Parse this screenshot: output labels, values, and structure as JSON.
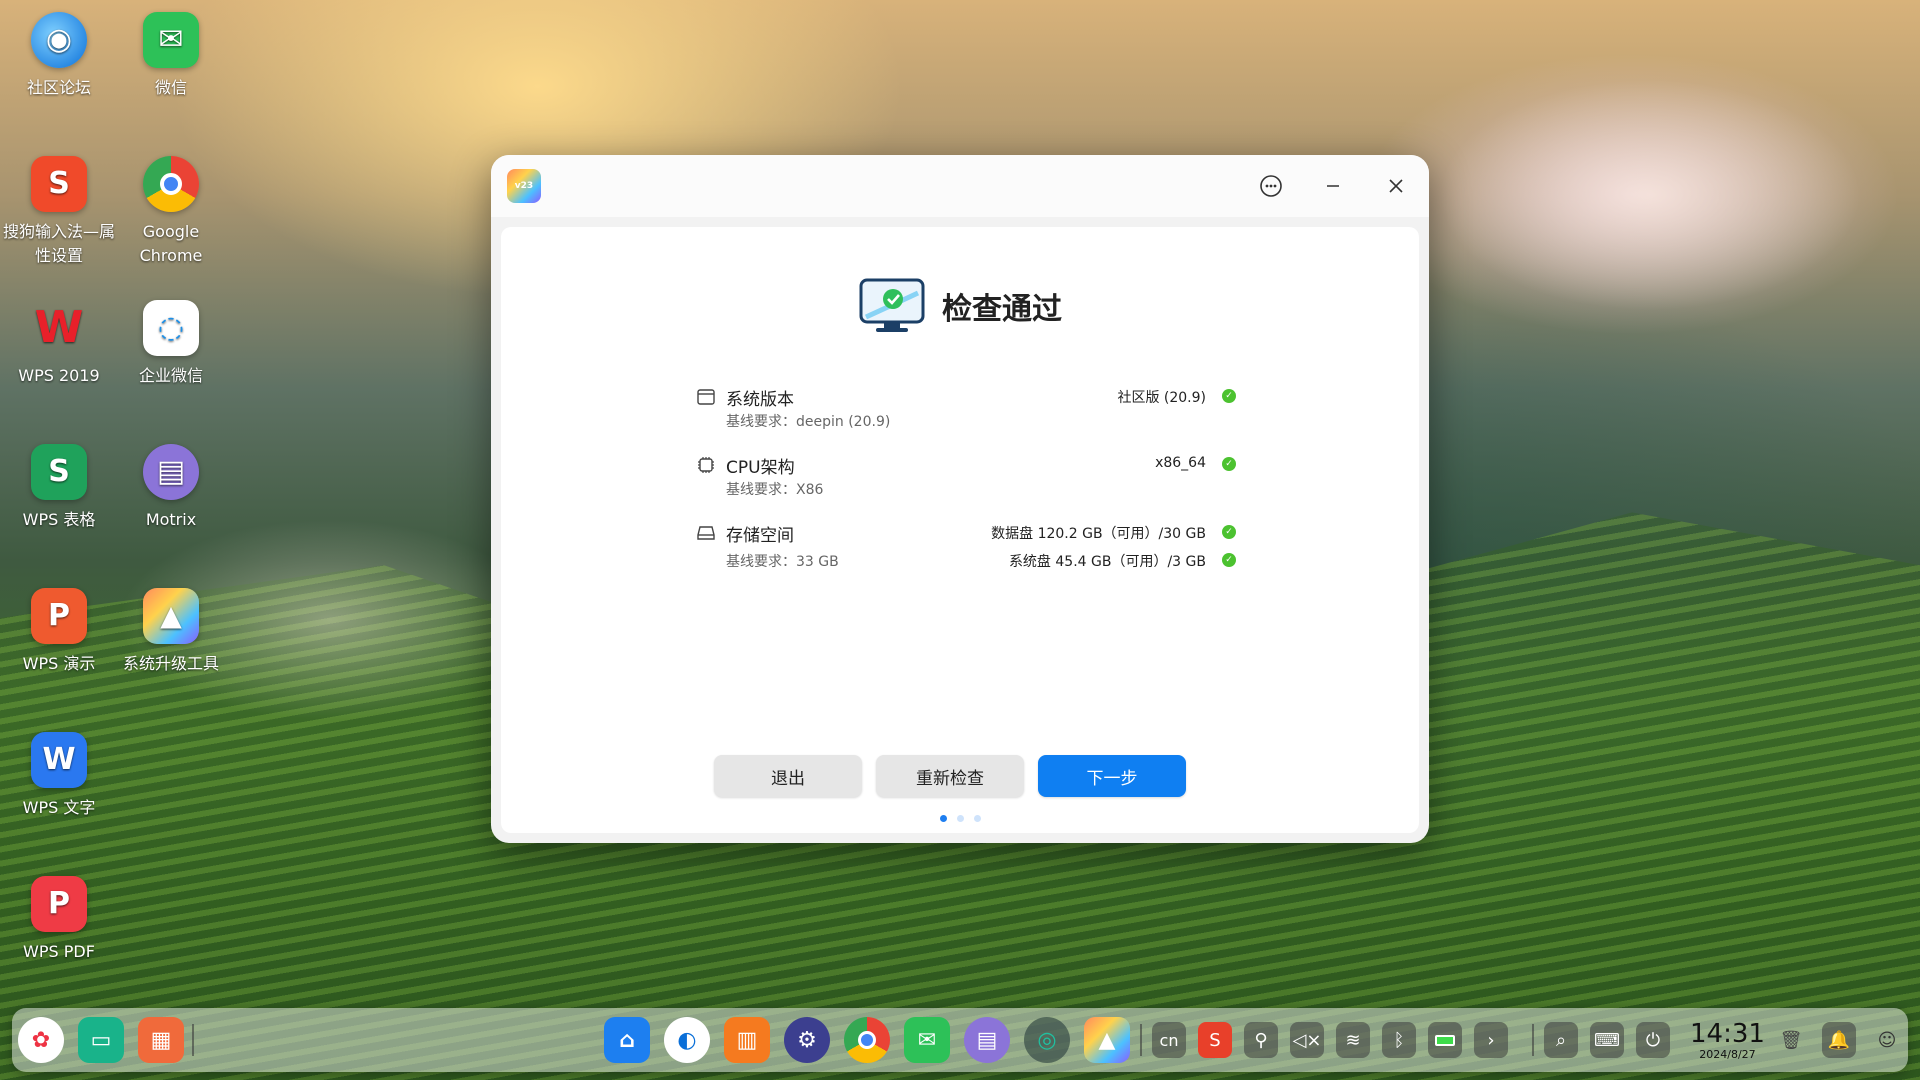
{
  "desktop": {
    "icons": [
      {
        "label": "社区论坛",
        "icon": "deepin-forum-icon"
      },
      {
        "label": "微信",
        "icon": "wechat-icon"
      },
      {
        "label": "搜狗输入法—属性设置",
        "icon": "sogou-input-icon"
      },
      {
        "label": "Google Chrome",
        "icon": "chrome-icon"
      },
      {
        "label": "WPS 2019",
        "icon": "wps-icon"
      },
      {
        "label": "企业微信",
        "icon": "wecom-icon"
      },
      {
        "label": "WPS 表格",
        "icon": "wps-sheet-icon"
      },
      {
        "label": "Motrix",
        "icon": "motrix-icon"
      },
      {
        "label": "WPS 演示",
        "icon": "wps-presentation-icon"
      },
      {
        "label": "系统升级工具",
        "icon": "upgrade-tool-icon"
      },
      {
        "label": "WPS 文字",
        "icon": "wps-writer-icon"
      },
      {
        "label": "WPS PDF",
        "icon": "wps-pdf-icon"
      }
    ]
  },
  "window": {
    "app_badge": "v23",
    "heading": "检查通过",
    "rows": [
      {
        "label": "系统版本",
        "sub": "基线要求：deepin (20.9)",
        "values": [
          "社区版 (20.9)"
        ]
      },
      {
        "label": "CPU架构",
        "sub": "基线要求：X86",
        "values": [
          "x86_64"
        ]
      },
      {
        "label": "存储空间",
        "sub": "基线要求：33 GB",
        "values": [
          "数据盘 120.2 GB（可用）/30 GB",
          "系统盘 45.4 GB（可用）/3 GB"
        ]
      }
    ],
    "buttons": {
      "exit": "退出",
      "recheck": "重新检查",
      "next": "下一步"
    },
    "pager": {
      "total": 3,
      "current": 1
    }
  },
  "dock": {
    "tray_lang": "cn",
    "clock_time": "14:31",
    "clock_date": "2024/8/27"
  },
  "colors": {
    "primary": "#0f7ff2",
    "check": "#4cc230"
  }
}
